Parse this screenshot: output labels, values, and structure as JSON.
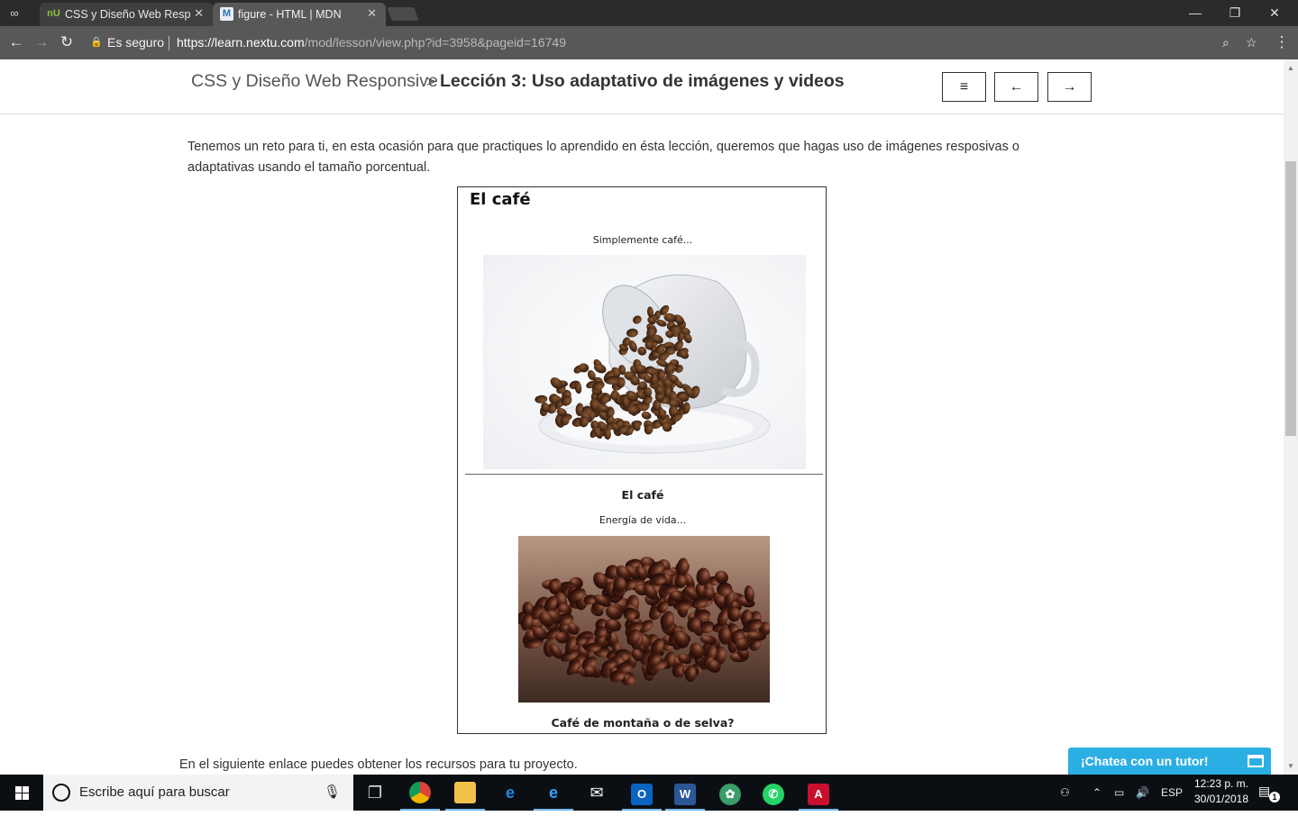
{
  "browser": {
    "tabs": [
      {
        "label": "CSS y Diseño Web Respo",
        "favicon": "nU",
        "close": "✕"
      },
      {
        "label": "figure - HTML | MDN",
        "favicon": "M",
        "close": "✕"
      }
    ],
    "window_controls": {
      "minimize": "—",
      "maximize": "❐",
      "close": "✕"
    },
    "security_label": "Es seguro",
    "url_host": "https://learn.nextu.com",
    "url_path": "/mod/lesson/view.php?id=3958&pageid=16749",
    "icons": [
      "incognito-icon",
      "back-icon",
      "forward-icon",
      "reload-icon",
      "lock-icon",
      "zoom-icon",
      "star-icon",
      "menu-icon"
    ]
  },
  "header": {
    "course": "CSS y Diseño Web Responsive",
    "separator": ">",
    "lesson": "Lección 3: Uso adaptativo de imágenes y videos",
    "buttons": {
      "menu": "≡",
      "prev": "←",
      "next": "→"
    }
  },
  "content": {
    "intro": "Tenemos un reto para ti, en esta ocasión para que practiques lo aprendido en ésta lección, queremos que hagas uso de imágenes resposivas o adaptativas usando el tamaño porcentual.",
    "demo": {
      "title": "El café",
      "caption1": "Simplemente café...",
      "heading2": "El café",
      "caption2": "Energía de vida...",
      "caption3": "Café de montaña o de selva?"
    },
    "outro": "En el siguiente enlace puedes obtener los recursos para tu proyecto."
  },
  "chat": {
    "label": "¡Chatea con un tutor!"
  },
  "taskbar": {
    "search_placeholder": "Escribe aquí para buscar",
    "language": "ESP",
    "time": "12:23 p. m.",
    "date": "30/01/2018",
    "notifications": "1",
    "accent": "#2baee3"
  }
}
